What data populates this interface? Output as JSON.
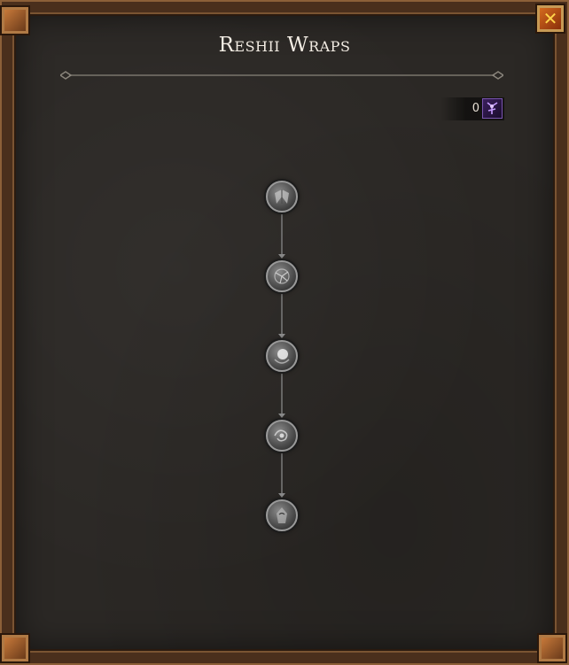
{
  "window": {
    "title": "Reshii Wraps",
    "close_icon": "close-x-icon"
  },
  "currency": {
    "amount": "0",
    "icon": "purple-rune-icon"
  },
  "talent_nodes": [
    {
      "icon": "wings-icon"
    },
    {
      "icon": "cracked-sigil-icon"
    },
    {
      "icon": "moon-orb-icon"
    },
    {
      "icon": "swirl-burst-icon"
    },
    {
      "icon": "hooded-figure-icon"
    }
  ],
  "colors": {
    "frame": "#4a2f1c",
    "background": "#2b2825",
    "title": "#f2ece3",
    "close_button": "#d46a1e",
    "currency_icon": "#3a1f5c"
  }
}
